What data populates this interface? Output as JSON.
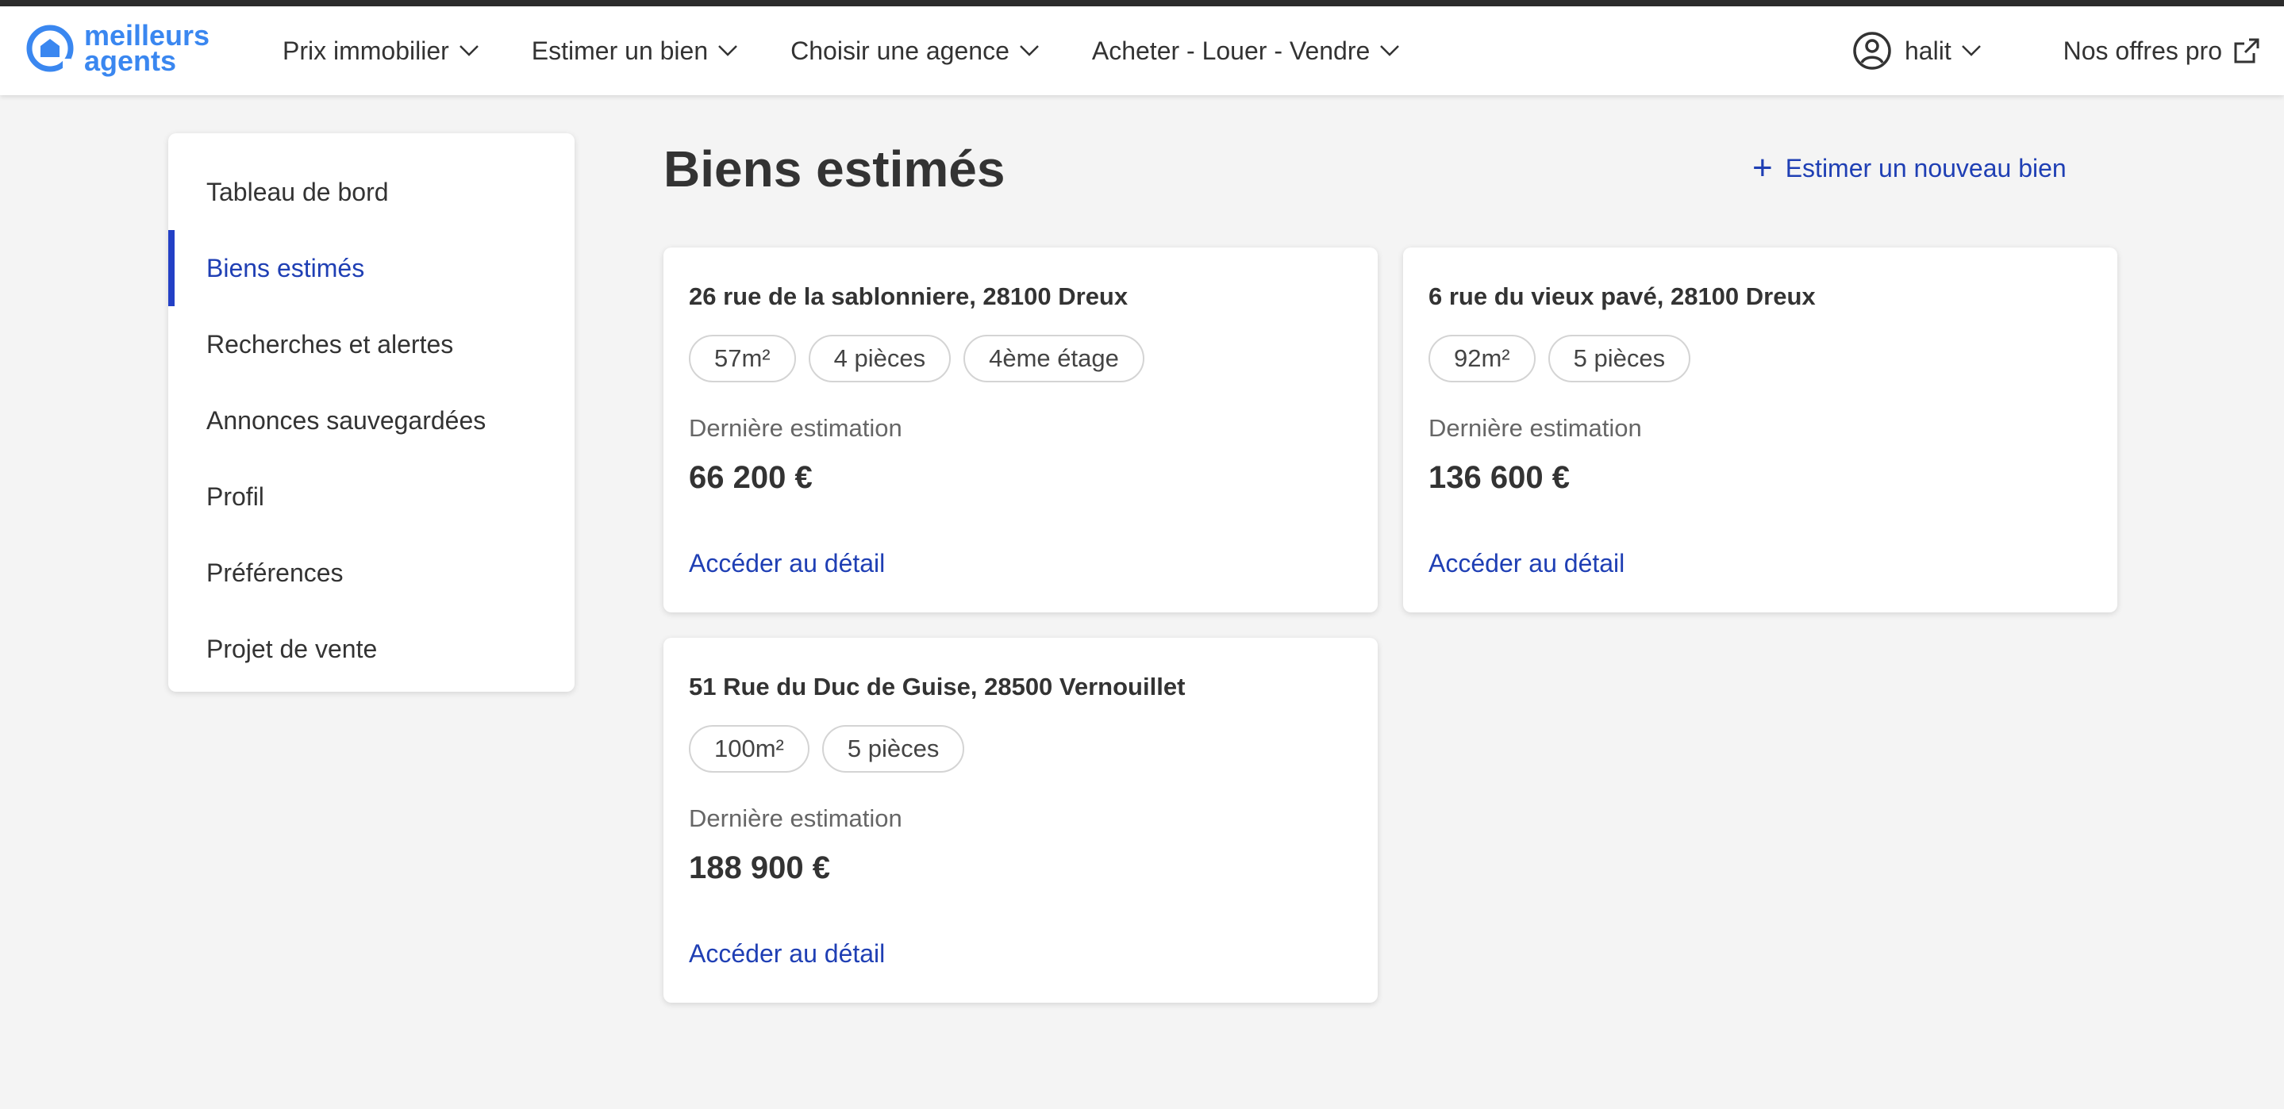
{
  "brand": {
    "logo_line1": "meilleurs",
    "logo_line2": "agents",
    "color": "#3a87f0"
  },
  "nav": {
    "items": [
      {
        "label": "Prix immobilier"
      },
      {
        "label": "Estimer un bien"
      },
      {
        "label": "Choisir une agence"
      },
      {
        "label": "Acheter - Louer - Vendre"
      }
    ],
    "user_name": "halit",
    "pro_label": "Nos offres pro"
  },
  "sidebar": {
    "items": [
      {
        "label": "Tableau de bord"
      },
      {
        "label": "Biens estimés",
        "active": true
      },
      {
        "label": "Recherches et alertes"
      },
      {
        "label": "Annonces sauvegardées"
      },
      {
        "label": "Profil"
      },
      {
        "label": "Préférences"
      },
      {
        "label": "Projet de vente"
      }
    ]
  },
  "main": {
    "title": "Biens estimés",
    "new_button": "Estimer un nouveau bien",
    "cards": [
      {
        "address": "26 rue de la sablonniere, 28100 Dreux",
        "tags": [
          "57m²",
          "4 pièces",
          "4ème étage"
        ],
        "estimation_label": "Dernière estimation",
        "estimation_value": "66 200 €",
        "detail_link": "Accéder au détail"
      },
      {
        "address": "6 rue du vieux pavé, 28100 Dreux",
        "tags": [
          "92m²",
          "5 pièces"
        ],
        "estimation_label": "Dernière estimation",
        "estimation_value": "136 600 €",
        "detail_link": "Accéder au détail"
      },
      {
        "address": "51 Rue du Duc de Guise, 28500 Vernouillet",
        "tags": [
          "100m²",
          "5 pièces"
        ],
        "estimation_label": "Dernière estimation",
        "estimation_value": "188 900 €",
        "detail_link": "Accéder au détail"
      }
    ]
  },
  "colors": {
    "accent": "#1f3fb4",
    "active_bar": "#2340c6",
    "background": "#f4f4f4"
  }
}
